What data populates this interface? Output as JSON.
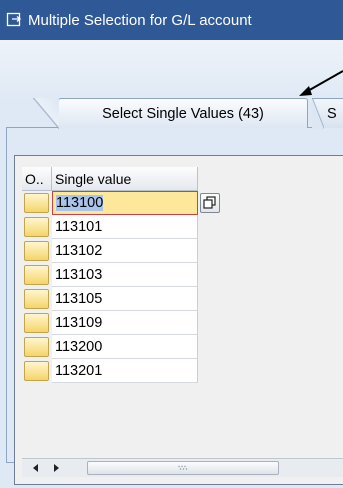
{
  "window": {
    "title": "Multiple Selection for G/L account"
  },
  "tabs": [
    {
      "label": "Select Single Values (43)"
    },
    {
      "label": "S"
    }
  ],
  "table": {
    "columns": [
      "O..",
      "Single value"
    ],
    "rows": [
      {
        "value": "113100"
      },
      {
        "value": "113101"
      },
      {
        "value": "113102"
      },
      {
        "value": "113103"
      },
      {
        "value": "113105"
      },
      {
        "value": "113109"
      },
      {
        "value": "113200"
      },
      {
        "value": "113201"
      }
    ]
  },
  "colors": {
    "titlebar": "#2f5897",
    "background": "#dfe9f5",
    "selection_button": "#f5d56b",
    "active_cell": "#fde79a",
    "focus_border": "#d04040"
  },
  "icons": [
    "window-title-icon",
    "callout-arrow-icon",
    "multiple-selection-icon",
    "scroll-left-icon",
    "scroll-right-icon",
    "grip-icon"
  ]
}
